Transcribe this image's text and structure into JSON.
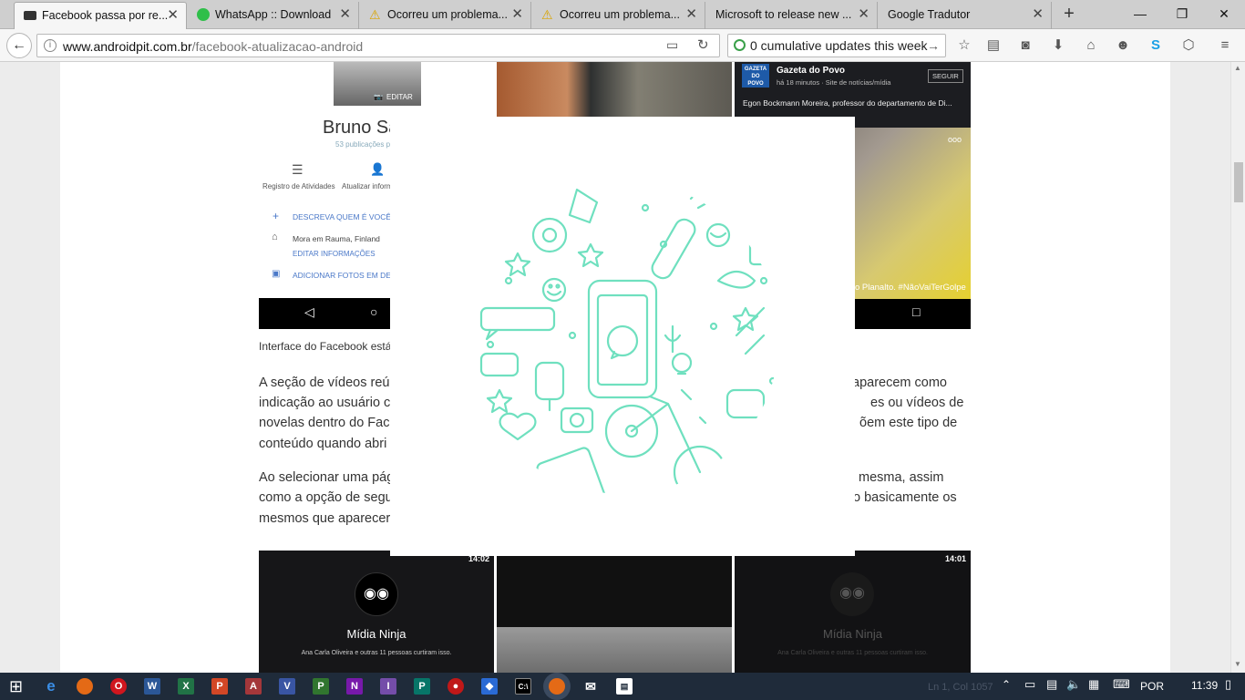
{
  "tabs": [
    {
      "title": "Facebook passa por re...",
      "active": true
    },
    {
      "title": "WhatsApp :: Download"
    },
    {
      "title": "Ocorreu um problema..."
    },
    {
      "title": "Ocorreu um problema..."
    },
    {
      "title": "Microsoft to release new ..."
    },
    {
      "title": "Google Tradutor"
    }
  ],
  "address": {
    "domain": "www.androidpit.com.br",
    "path": "/facebook-atualizacao-android"
  },
  "search": {
    "value": "0 cumulative updates this week"
  },
  "phone1": {
    "edit_label": "EDITAR",
    "name": "Bruno Sa",
    "posts": "53 publicações p",
    "activity_log": "Registro de Atividades",
    "update_info": "Atualizar inform",
    "describe": "DESCREVA QUEM É VOCÊ",
    "lives_in": "Mora em Rauma, Finland",
    "edit_info": "EDITAR INFORMAÇÕES",
    "add_photos": "ADICIONAR FOTOS EM DES"
  },
  "phone3": {
    "page": "Gazeta do Povo",
    "time": "há 18 minutos · Site de notícias/mídia",
    "follow": "SEGUIR",
    "post": "Egon Bockmann Moreira, professor do departamento de Di...",
    "video_caption": "o Planalto. #NãoVaiTerGolpe",
    "logo": "GAZETA DO POVO"
  },
  "caption": "Interface do Facebook está",
  "paragraphs": [
    [
      "A seção de vídeos reú",
      "aparecem como"
    ],
    [
      "indicação ao usuário c",
      "es ou vídeos de"
    ],
    [
      "novelas dentro do Fac",
      "õem este tipo de"
    ],
    [
      "conteúdo quando abri",
      ""
    ],
    [
      "Ao selecionar uma pág",
      "mesma, assim"
    ],
    [
      "como a opção de segu",
      "o basicamente os"
    ],
    [
      "mesmos que aparecer",
      ""
    ]
  ],
  "bottom_phones": {
    "time1": "14:02",
    "time3": "14:01",
    "page": "Mídia Ninja",
    "likes": "Ana Carla Oliveira e outras 11 pessoas curtiram isso."
  },
  "taskbar": {
    "language": "POR",
    "clock": "11:39",
    "status_ghost": "Ln 1, Col 1057"
  },
  "colors": {
    "accent": "#6fe0bf",
    "facebook_blue": "#4a78c8",
    "taskbar": "#1f2b3a"
  }
}
